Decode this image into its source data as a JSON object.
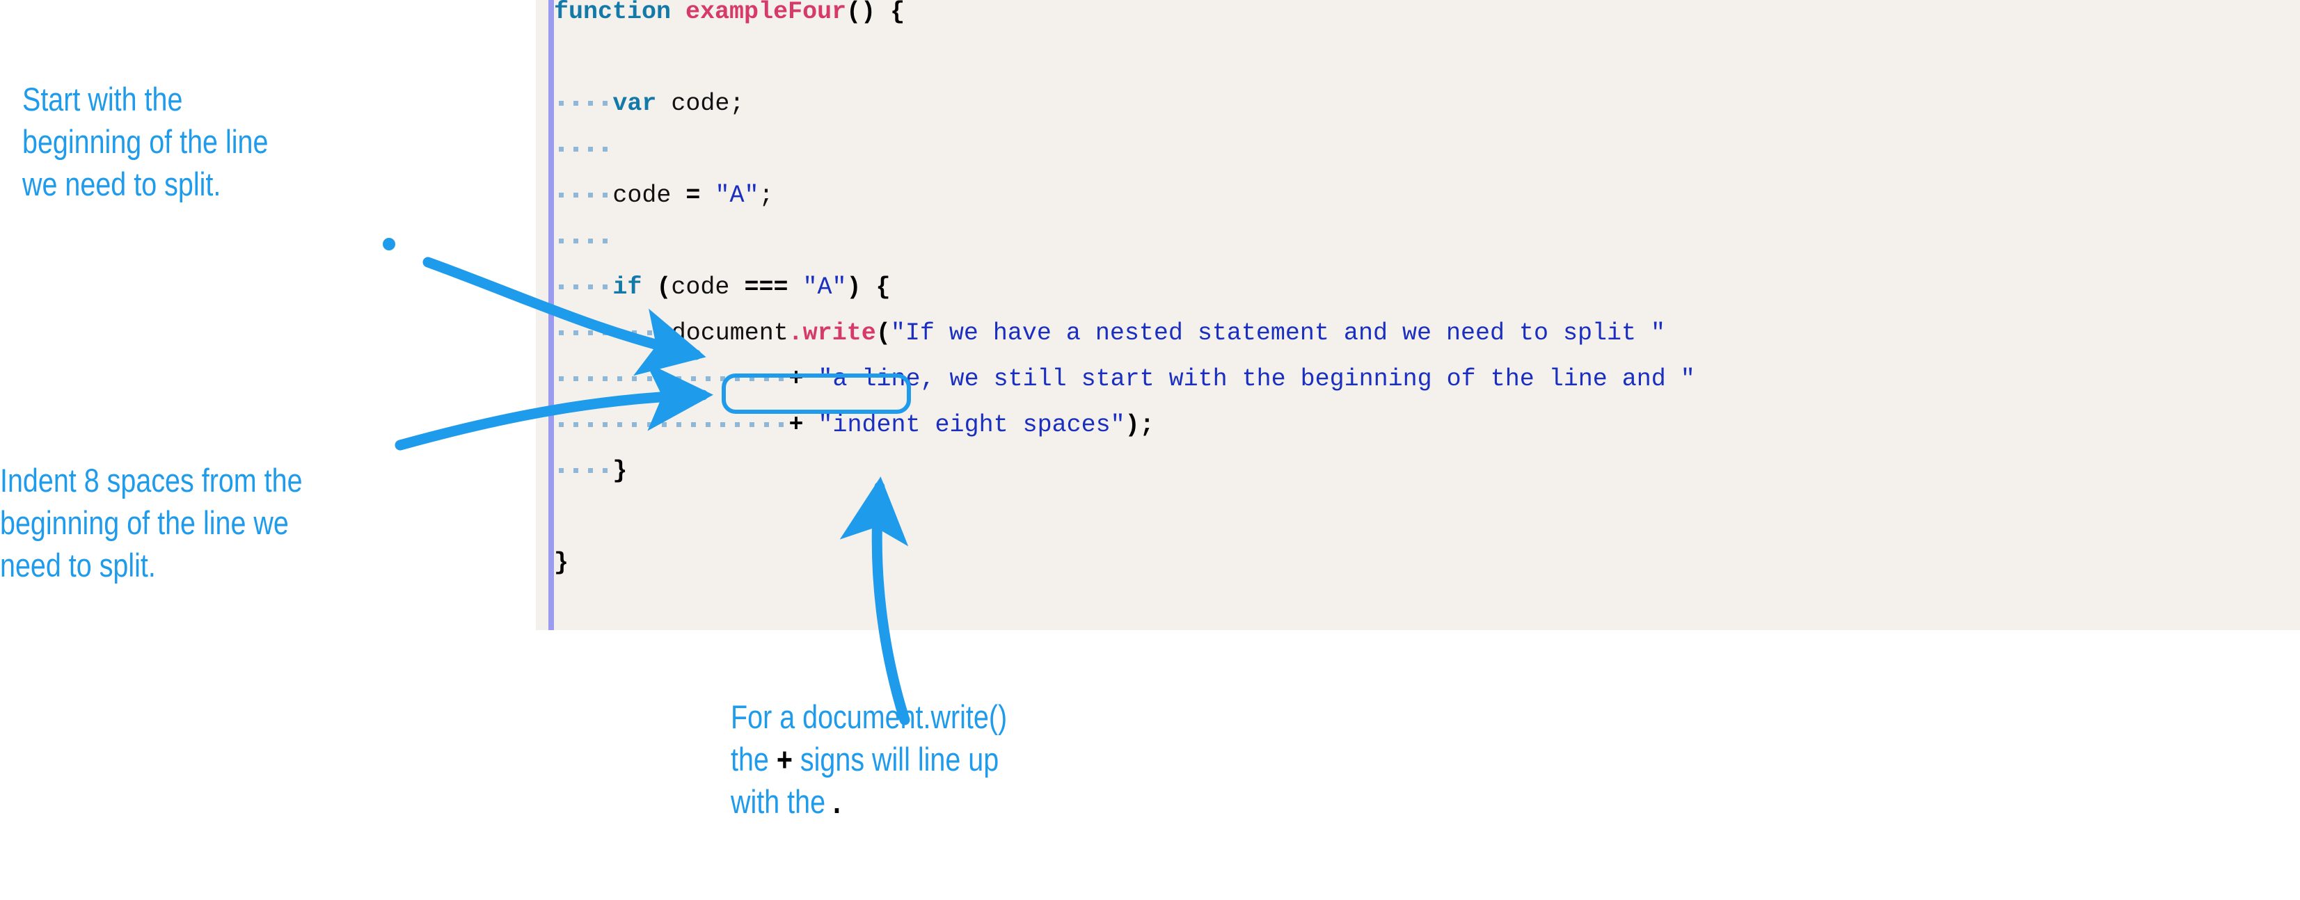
{
  "accent_color": "#1f9bec",
  "code_panel": {
    "background": "#f4f0ec",
    "gutter_color": "#9b9bf0",
    "language": "javascript",
    "lines": [
      {
        "indent": 0,
        "tokens": [
          {
            "t": "kw",
            "v": "function"
          },
          {
            "t": "plain",
            "v": " "
          },
          {
            "t": "fname",
            "v": "exampleFour"
          },
          {
            "t": "punc",
            "v": "() {"
          }
        ]
      },
      {
        "indent": 0,
        "tokens": []
      },
      {
        "indent": 4,
        "tokens": [
          {
            "t": "kw",
            "v": "var"
          },
          {
            "t": "plain",
            "v": " code;"
          }
        ]
      },
      {
        "indent": 4,
        "tokens": []
      },
      {
        "indent": 4,
        "tokens": [
          {
            "t": "plain",
            "v": "code "
          },
          {
            "t": "op",
            "v": "="
          },
          {
            "t": "plain",
            "v": " "
          },
          {
            "t": "str",
            "v": "\"A\""
          },
          {
            "t": "plain",
            "v": ";"
          }
        ]
      },
      {
        "indent": 4,
        "tokens": []
      },
      {
        "indent": 4,
        "tokens": [
          {
            "t": "kw",
            "v": "if"
          },
          {
            "t": "plain",
            "v": " "
          },
          {
            "t": "punc",
            "v": "("
          },
          {
            "t": "plain",
            "v": "code "
          },
          {
            "t": "op",
            "v": "==="
          },
          {
            "t": "plain",
            "v": " "
          },
          {
            "t": "str",
            "v": "\"A\""
          },
          {
            "t": "punc",
            "v": ") {"
          }
        ]
      },
      {
        "indent": 8,
        "tokens": [
          {
            "t": "plain",
            "v": "document"
          },
          {
            "t": "fname",
            "v": ".write"
          },
          {
            "t": "punc",
            "v": "("
          },
          {
            "t": "str",
            "v": "\"If we have a nested statement and we need to split \""
          }
        ]
      },
      {
        "indent": 16,
        "tokens": [
          {
            "t": "op",
            "v": "+"
          },
          {
            "t": "plain",
            "v": " "
          },
          {
            "t": "str",
            "v": "\"a line, we still start with the beginning of the line and \""
          }
        ]
      },
      {
        "indent": 16,
        "tokens": [
          {
            "t": "op",
            "v": "+"
          },
          {
            "t": "plain",
            "v": " "
          },
          {
            "t": "str",
            "v": "\"indent eight spaces\""
          },
          {
            "t": "punc",
            "v": ");"
          }
        ]
      },
      {
        "indent": 4,
        "tokens": [
          {
            "t": "punc",
            "v": "}"
          }
        ]
      },
      {
        "indent": 0,
        "tokens": []
      },
      {
        "indent": 0,
        "tokens": [
          {
            "t": "punc",
            "v": "}"
          }
        ]
      }
    ],
    "highlight_box": {
      "label": "eight-space-indent-highlight",
      "line_index": 8,
      "space_count": 8,
      "color": "#1f9bec"
    }
  },
  "annotations": {
    "start_of_line": {
      "text": "Start with the\nbeginning of the line\nwe need to split.",
      "color": "#1f9bec"
    },
    "indent_eight": {
      "text": "Indent 8 spaces from the\nbeginning of the line we\nneed to split.",
      "color": "#1f9bec"
    },
    "plus_alignment": {
      "line1": "For a document.write()",
      "line2_a": "the ",
      "line2_plus": "+",
      "line2_b": " signs will line up",
      "line3_a": "with the ",
      "line3_dot": ".",
      "color": "#1f9bec"
    }
  },
  "arrows": [
    {
      "name": "arrow-to-document-line",
      "from": "start_of_line annotation",
      "to": "document.write line start"
    },
    {
      "name": "arrow-to-indent-box",
      "from": "indent_eight annotation",
      "to": "eight-space highlight box"
    },
    {
      "name": "arrow-to-plus-sign",
      "from": "plus_alignment annotation",
      "to": "plus operator on line 9"
    }
  ]
}
